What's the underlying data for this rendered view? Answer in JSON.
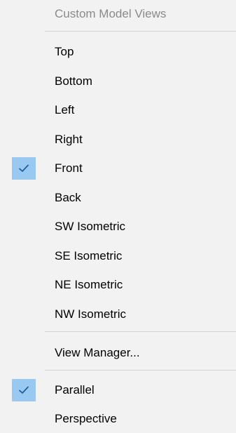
{
  "menu": {
    "header": "Custom Model Views",
    "views": [
      {
        "label": "Top",
        "checked": false
      },
      {
        "label": "Bottom",
        "checked": false
      },
      {
        "label": "Left",
        "checked": false
      },
      {
        "label": "Right",
        "checked": false
      },
      {
        "label": "Front",
        "checked": true
      },
      {
        "label": "Back",
        "checked": false
      },
      {
        "label": "SW Isometric",
        "checked": false
      },
      {
        "label": "SE Isometric",
        "checked": false
      },
      {
        "label": "NE Isometric",
        "checked": false
      },
      {
        "label": "NW Isometric",
        "checked": false
      }
    ],
    "view_manager": "View Manager...",
    "projection": [
      {
        "label": "Parallel",
        "checked": true
      },
      {
        "label": "Perspective",
        "checked": false
      }
    ],
    "check_icon": "checkmark-icon",
    "colors": {
      "background": "#f2f2f2",
      "check_highlight": "#99c9f0",
      "check_mark": "#1f5f9f",
      "disabled_text": "#8a8a8a",
      "separator": "#d4d4d4"
    }
  }
}
